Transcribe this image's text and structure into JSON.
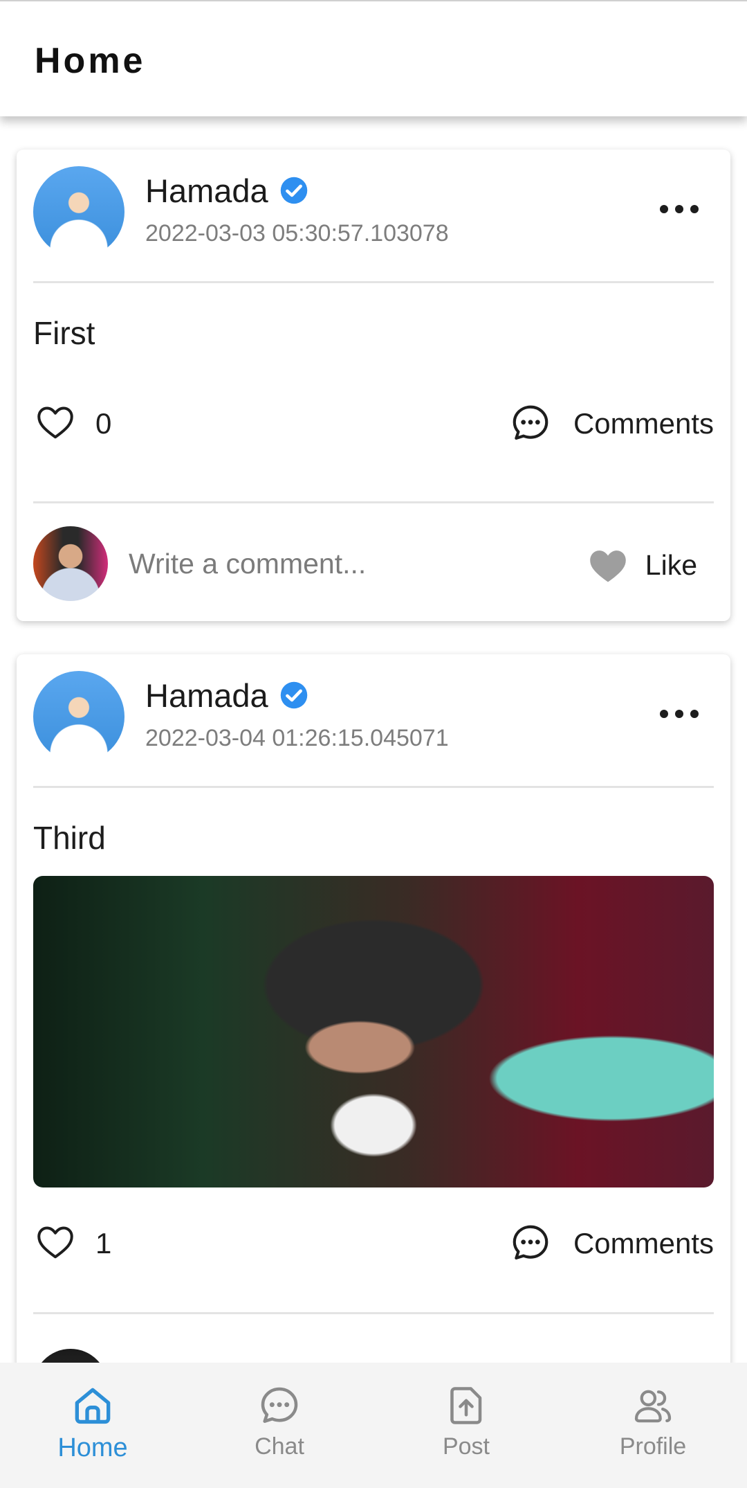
{
  "app_bar": {
    "title": "Home"
  },
  "posts": [
    {
      "author": "Hamada",
      "time": "2022-03-03 05:30:57.103078",
      "text": "First",
      "likes": "0",
      "comments_label": "Comments",
      "comment_placeholder": "Write a comment...",
      "like_label": "Like"
    },
    {
      "author": "Hamada",
      "time": "2022-03-04 01:26:15.045071",
      "text": "Third",
      "likes": "1",
      "comments_label": "Comments"
    }
  ],
  "bottom_nav": {
    "items": [
      {
        "label": "Home",
        "icon": "home-icon",
        "active": true
      },
      {
        "label": "Chat",
        "icon": "chat-icon",
        "active": false
      },
      {
        "label": "Post",
        "icon": "upload-icon",
        "active": false
      },
      {
        "label": "Profile",
        "icon": "users-icon",
        "active": false
      }
    ]
  },
  "colors": {
    "accent": "#2d8fd7",
    "verified": "#2e8ff0",
    "muted_text": "#7d7d7d",
    "like_heart": "#9e9e9e"
  }
}
